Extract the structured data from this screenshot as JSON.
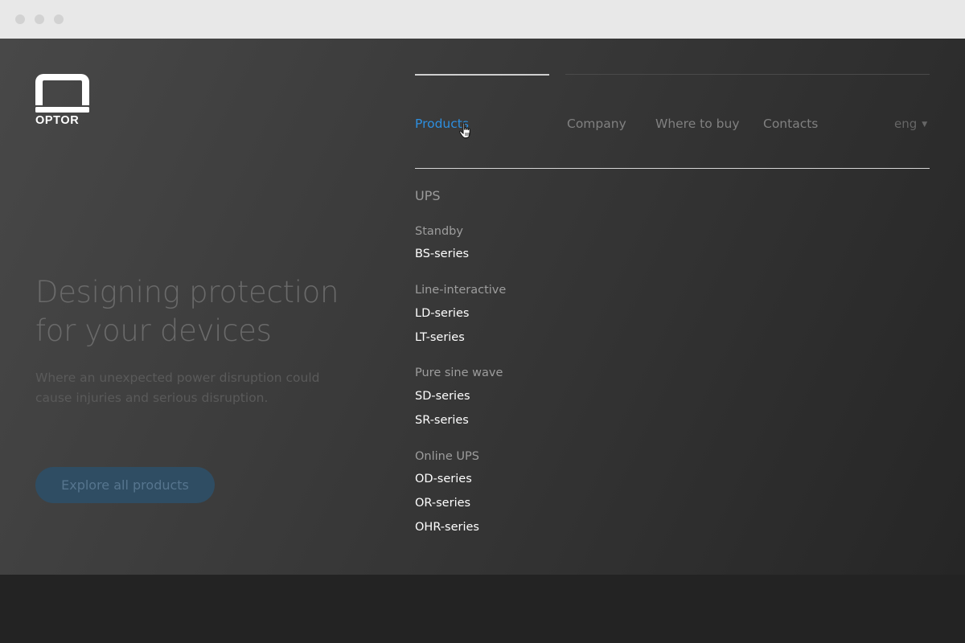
{
  "brand": {
    "name": "OPTOR"
  },
  "hero": {
    "headline_line1": "Designing protection",
    "headline_line2": "for your devices",
    "subline_line1": "Where an unexpected power disruption could",
    "subline_line2": "cause injuries and serious disruption.",
    "cta_label": "Explore all products"
  },
  "nav": {
    "items": [
      {
        "label": "Products",
        "active": true
      },
      {
        "label": "Company"
      },
      {
        "label": "Where to buy"
      },
      {
        "label": "Contacts"
      }
    ],
    "language": "eng",
    "active_color": "#2d8fe0"
  },
  "menu": {
    "title": "UPS",
    "groups": [
      {
        "category": "Standby",
        "items": [
          "BS-series"
        ]
      },
      {
        "category": "Line-interactive",
        "items": [
          "LD-series",
          "LT-series"
        ]
      },
      {
        "category": "Pure sine wave",
        "items": [
          "SD-series",
          "SR-series"
        ]
      },
      {
        "category": "Online UPS",
        "items": [
          "OD-series",
          "OR-series",
          "OHR-series"
        ]
      }
    ]
  },
  "icons": {
    "cursor": "hand-pointer-icon",
    "lang_caret": "caret-down-icon"
  }
}
